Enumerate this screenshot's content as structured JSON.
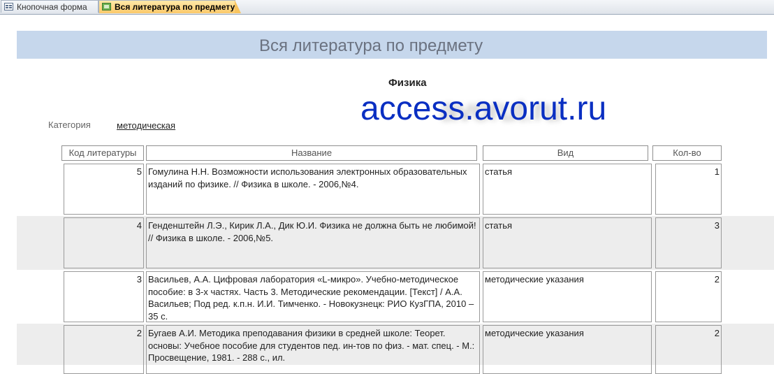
{
  "tabs": [
    {
      "label": "Кнопочная форма",
      "icon": "form-icon"
    },
    {
      "label": "Вся литература по предмету",
      "icon": "report-icon"
    }
  ],
  "report": {
    "title": "Вся литература по предмету",
    "subject": "Физика",
    "watermark": "access.avorut.ru",
    "watermark_shadow": "avorut.ru",
    "category_label": "Категория",
    "category_value": "методическая"
  },
  "columns": [
    "Код литературы",
    "Название",
    "Вид",
    "Кол-во"
  ],
  "rows": [
    {
      "id": "5",
      "name": "Гомулина Н.Н. Возможности использования электронных образовательных изданий по физике. // Физика в школе. - 2006,№4.",
      "kind": "статья",
      "qty": "1"
    },
    {
      "id": "4",
      "name": "Генденштейн Л.Э., Кирик Л.А., Дик Ю.И. Физика не должна быть не любимой! // Физика в школе. - 2006,№5.",
      "kind": "статья",
      "qty": "3"
    },
    {
      "id": "3",
      "name": " Васильев, А.А. Цифровая лаборатория «L-микро». Учебно-методическое пособие: в 3-х частях. Часть 3. Методические рекомендации. [Текст] / А.А.  Васильев; Под ред. к.п.н. И.И. Тимченко. - Новокузнецк: РИО КузГПА, 2010 – 35 с.",
      "kind": "методические указания",
      "qty": "2"
    },
    {
      "id": "2",
      "name": "Бугаев А.И. Методика преподавания физики в средней школе: Теорет. основы: Учебное пособие для студентов пед. ин-тов по физ. - мат. спец. - М.: Просвещение, 1981. - 288 с., ил.",
      "kind": "методические указания",
      "qty": "2"
    }
  ]
}
